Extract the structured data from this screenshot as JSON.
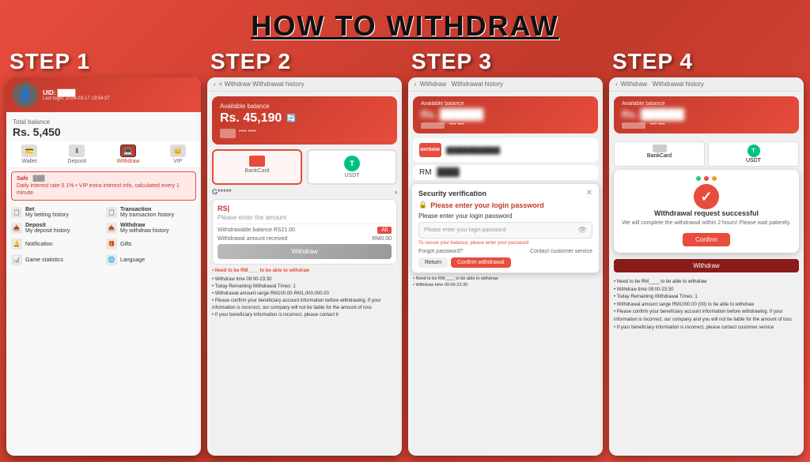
{
  "header": {
    "title": "HOW TO WITHDRAW"
  },
  "steps": [
    {
      "id": "step1",
      "label": "STEP 1",
      "user": {
        "uid": "UID: ████",
        "last_login": "Last login: 2024-03-17 19:54:37"
      },
      "balance_label": "Total balance",
      "balance_amount": "Rs. 5,450",
      "nav": [
        "Wallet",
        "Deposit",
        "Withdraw",
        "VIP"
      ],
      "safe_banner": "Safe\nDaily interest rate 0.1% • VIP extra interest info, calculated every 1 minute",
      "menu_items": [
        {
          "icon": "📋",
          "label": "Bet\nMy betting history"
        },
        {
          "icon": "📋",
          "label": "Transaction\nMy transaction history"
        },
        {
          "icon": "📥",
          "label": "Deposit\nMy deposit history"
        },
        {
          "icon": "📤",
          "label": "Withdraw\nMy withdraw history"
        },
        {
          "icon": "🔔",
          "label": "Notification"
        },
        {
          "icon": "🎁",
          "label": "Gifts"
        },
        {
          "icon": "📊",
          "label": "Game statistics"
        },
        {
          "icon": "🌐",
          "label": "Language"
        }
      ]
    },
    {
      "id": "step2",
      "label": "STEP 2",
      "top_bar": "< Withdraw    Withdrawal history",
      "available_label": "Available balance",
      "balance_amount": "Rs. 45,190",
      "tabs": [
        "BankCard",
        "USDT"
      ],
      "account_number": "G*****",
      "input": {
        "rs_label": "RS|",
        "placeholder": "Please enter the amount",
        "balance_label": "Withdrawable balance RS21.00",
        "all_label": "All",
        "amount": "RM0.00"
      },
      "withdraw_btn": "Withdraw",
      "notes": [
        "Need to be RM____ to be able to withdraw",
        "Withdraw time 09:00-23:30",
        "Today Remaining Withdrawal Times: 1",
        "Withdrawal amount range RM100.00-RM1,000,000.00",
        "Please confirm your beneficiary account information before withdrawing. If your information is incorrect, our company will not be liable for the amount of loss",
        "If your beneficiary information is incorrect, please contact customer service"
      ]
    },
    {
      "id": "step3",
      "label": "STEP 3",
      "balance_card": {
        "label": "Available balance",
        "amount": "Rs. ██████"
      },
      "bank": "MAYBANK",
      "amount": "RM ██",
      "security_modal": {
        "title": "Security verification",
        "lock_label": "Please enter your login password",
        "field_placeholder": "Please enter your login password",
        "warning": "To secure your balance, please enter your password",
        "forgot_password": "Forgot password?",
        "contact": "Contact customer service",
        "return_btn": "Return",
        "confirm_btn": "Confirm withdrawal"
      }
    },
    {
      "id": "step4",
      "label": "STEP 4",
      "balance_card": {
        "label": "Available balance",
        "amount": "Rs. ██████"
      },
      "success_modal": {
        "title": "Withdrawal request successful",
        "description": "We will complete the withdrawal within 2 hours!\nPlease wait patiently.",
        "confirm_btn": "Confirm"
      },
      "notes": [
        "Need to be RM____ to be able to withdraw",
        "Withdraw time 09:00-23:30",
        "Today Remaining Withdrawal Times: 1",
        "Withdrawal amount range RM1000.00 (00) to be able to withdraw",
        "Please confirm your beneficiary account information before withdrawing. If your information is incorrect, our company will not be liable for the amount of loss",
        "If your beneficiary information is incorrect, please contact customer service"
      ]
    }
  ]
}
